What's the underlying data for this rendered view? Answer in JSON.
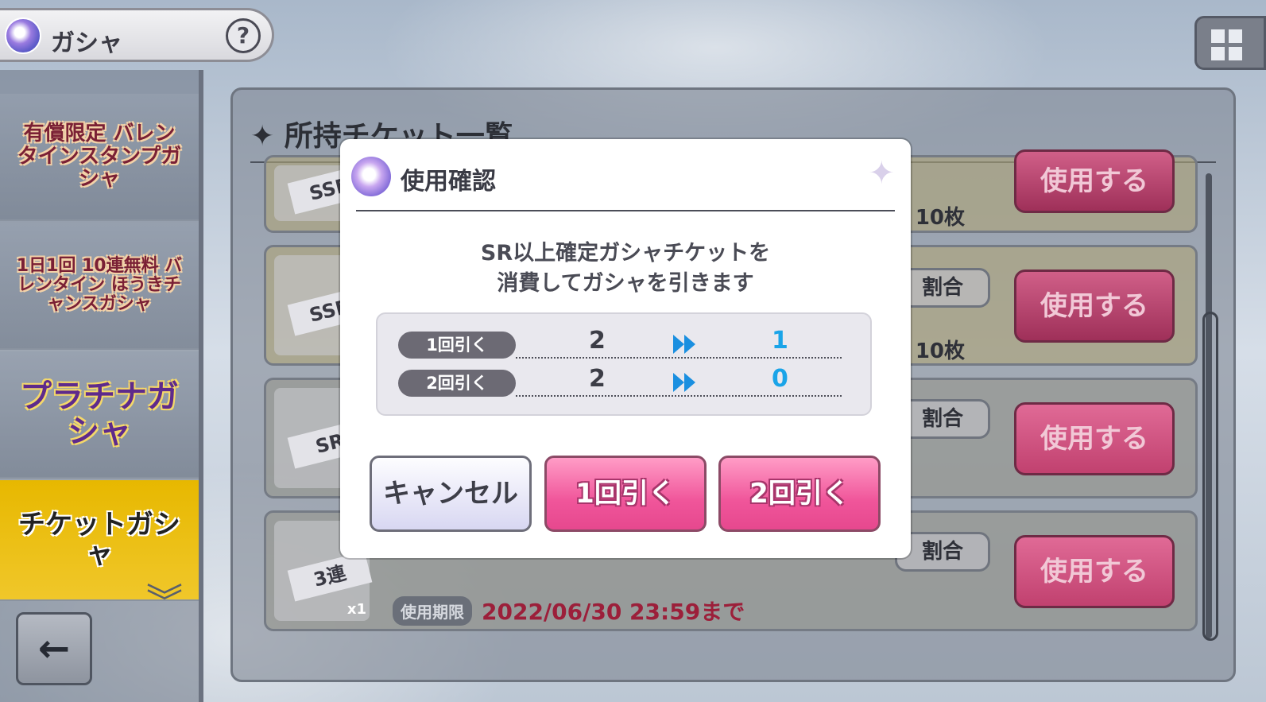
{
  "header": {
    "title": "ガシャ",
    "help_label": "?"
  },
  "sidebar": {
    "items": [
      {
        "label": "有償限定 バレンタインスタンプガシャ"
      },
      {
        "label": "1日1回 10連無料 バレンタイン ほうきチャンスガシャ"
      },
      {
        "label": "プラチナガシャ"
      },
      {
        "label": "チケットガシャ"
      }
    ],
    "back_label": "←"
  },
  "panel": {
    "title": "✦ 所持チケット一覧",
    "rows": [
      {
        "ticket_label": "SSR",
        "count": "10枚",
        "use_label": "使用する"
      },
      {
        "ticket_label": "SSR",
        "count": "10枚",
        "ratio_label": "割合",
        "use_label": "使用する"
      },
      {
        "ticket_label": "SR",
        "ratio_label": "割合",
        "use_label": "使用する"
      },
      {
        "ticket_label": "3連",
        "ticket_qty": "x1",
        "ratio_label": "割合",
        "use_label": "使用する",
        "expiry_tag": "使用期限",
        "expiry_date": "2022/06/30 23:59まで"
      }
    ]
  },
  "dialog": {
    "title": "使用確認",
    "message_line1": "SR以上確定ガシャチケットを",
    "message_line2": "消費してガシャを引きます",
    "rows": [
      {
        "label": "1回引く",
        "before": "2",
        "after": "1"
      },
      {
        "label": "2回引く",
        "before": "2",
        "after": "0"
      }
    ],
    "cancel_label": "キャンセル",
    "draw1_label": "1回引く",
    "draw2_label": "2回引く"
  },
  "colors": {
    "accent_pink": "#f0559a",
    "after_value_blue": "#1aa4e8",
    "expiry_red": "#9c1f3a"
  }
}
